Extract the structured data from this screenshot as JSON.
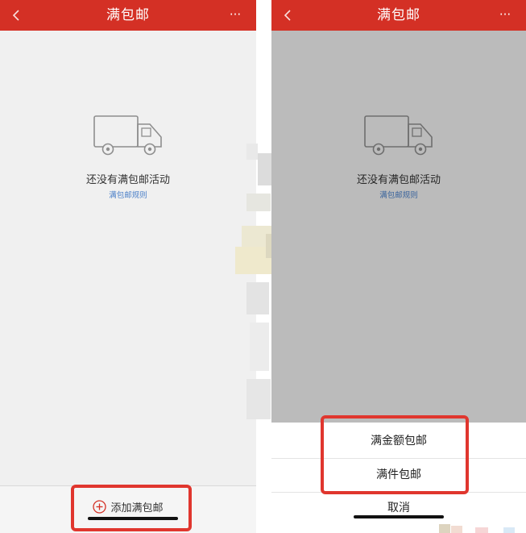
{
  "left_screen": {
    "navbar": {
      "back_icon": "chevron-left-icon",
      "title": "满包邮",
      "more_icon": "more-dots-icon",
      "more_glyph": "···"
    },
    "empty_state": {
      "icon": "truck-icon",
      "title": "还没有满包邮活动",
      "rules_link": "满包邮规则"
    },
    "bottom_bar": {
      "add_icon": "plus-circle-icon",
      "add_label": "添加满包邮"
    }
  },
  "right_screen": {
    "navbar": {
      "back_icon": "chevron-left-icon",
      "title": "满包邮",
      "more_icon": "more-dots-icon",
      "more_glyph": "···"
    },
    "empty_state": {
      "icon": "truck-icon",
      "title": "还没有满包邮活动",
      "rules_link": "满包邮规则"
    },
    "action_sheet": {
      "options": [
        {
          "label": "满金额包邮"
        },
        {
          "label": "满件包邮"
        }
      ],
      "cancel_label": "取消"
    }
  },
  "colors": {
    "nav_red": "#d43025",
    "highlight_red": "#e0362e",
    "link_blue": "#4a7fc8"
  }
}
